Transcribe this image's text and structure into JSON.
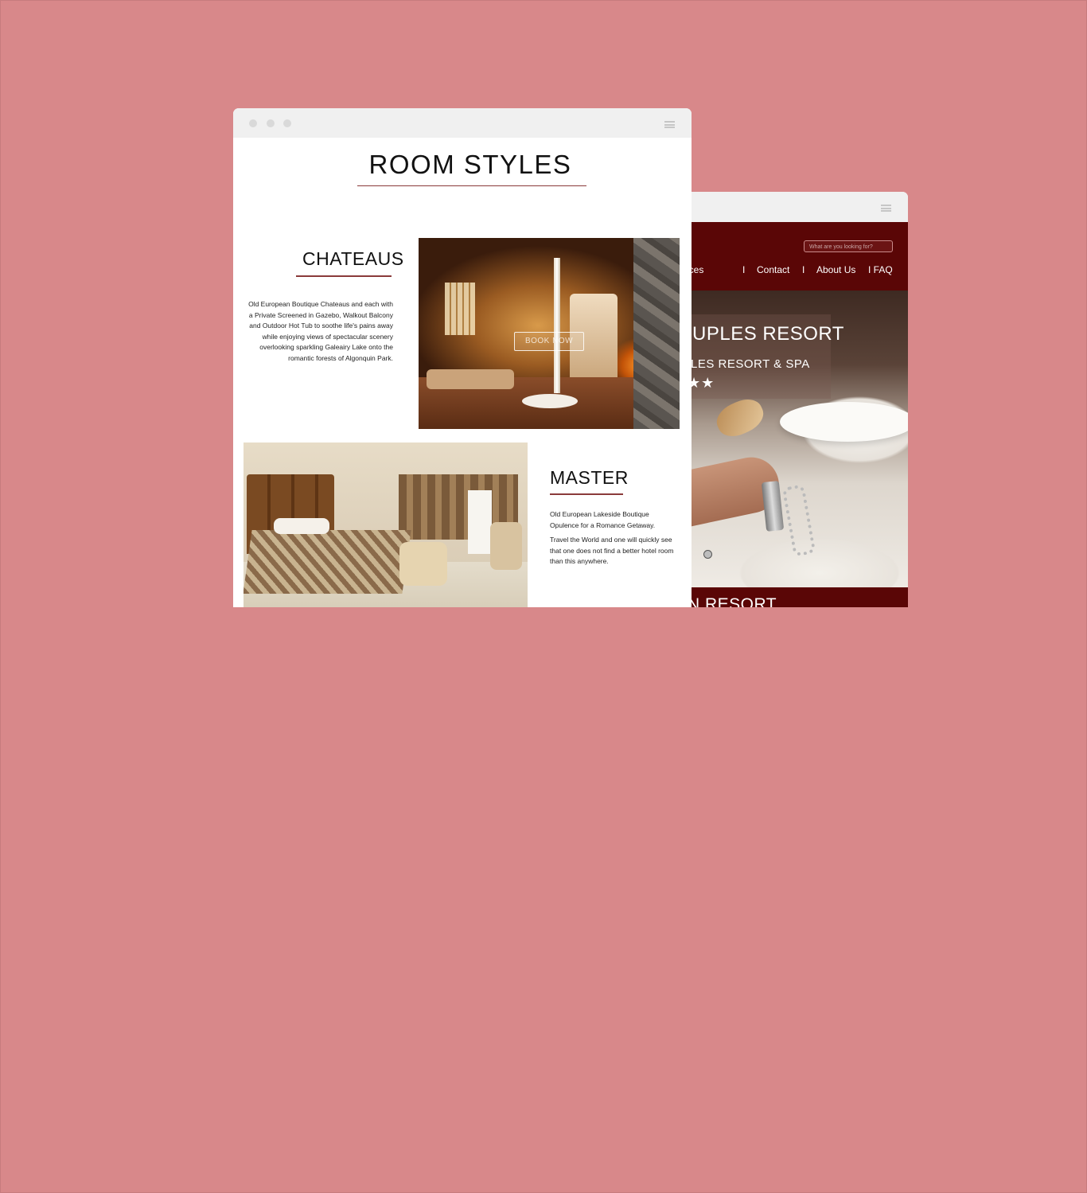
{
  "back_site": {
    "search_placeholder": "What are you looking for?",
    "nav": {
      "services": "r services",
      "sep1": "I",
      "contact": "Contact",
      "sep2": "I",
      "about": "About Us",
      "faq": "I FAQ"
    },
    "hero": {
      "title": "UPLES RESORT",
      "subtitle": "LES RESORT & SPA",
      "stars": "★★",
      "slide_indicator_count": 2
    },
    "footer_heading": "N RESORT"
  },
  "front_site": {
    "page_title": "ROOM STYLES",
    "sections": [
      {
        "title": "CHATEAUS",
        "description": "Old European Boutique Chateaus and each with a Private Screened in Gazebo, Walkout Balcony and Outdoor Hot Tub to soothe life's pains away while enjoying views of spectacular scenery overlooking sparkling Galeairy Lake onto the romantic forests of Algonquin Park.",
        "button_label": "BOOK NOW"
      },
      {
        "title": "MASTER",
        "description_lines": [
          "Old European Lakeside Boutique Opulence for a Romance Getaway.",
          "Travel the World and one will quickly see that one does not find a better hotel room than this anywhere."
        ]
      }
    ]
  },
  "colors": {
    "background": "#d8888a",
    "brand_dark_red": "#5a0606",
    "accent_rule": "#8a3a3a",
    "browser_chrome": "#f0f0f0"
  },
  "icons": {
    "window_controls": "traffic-light-dots",
    "menu": "hamburger-icon"
  }
}
